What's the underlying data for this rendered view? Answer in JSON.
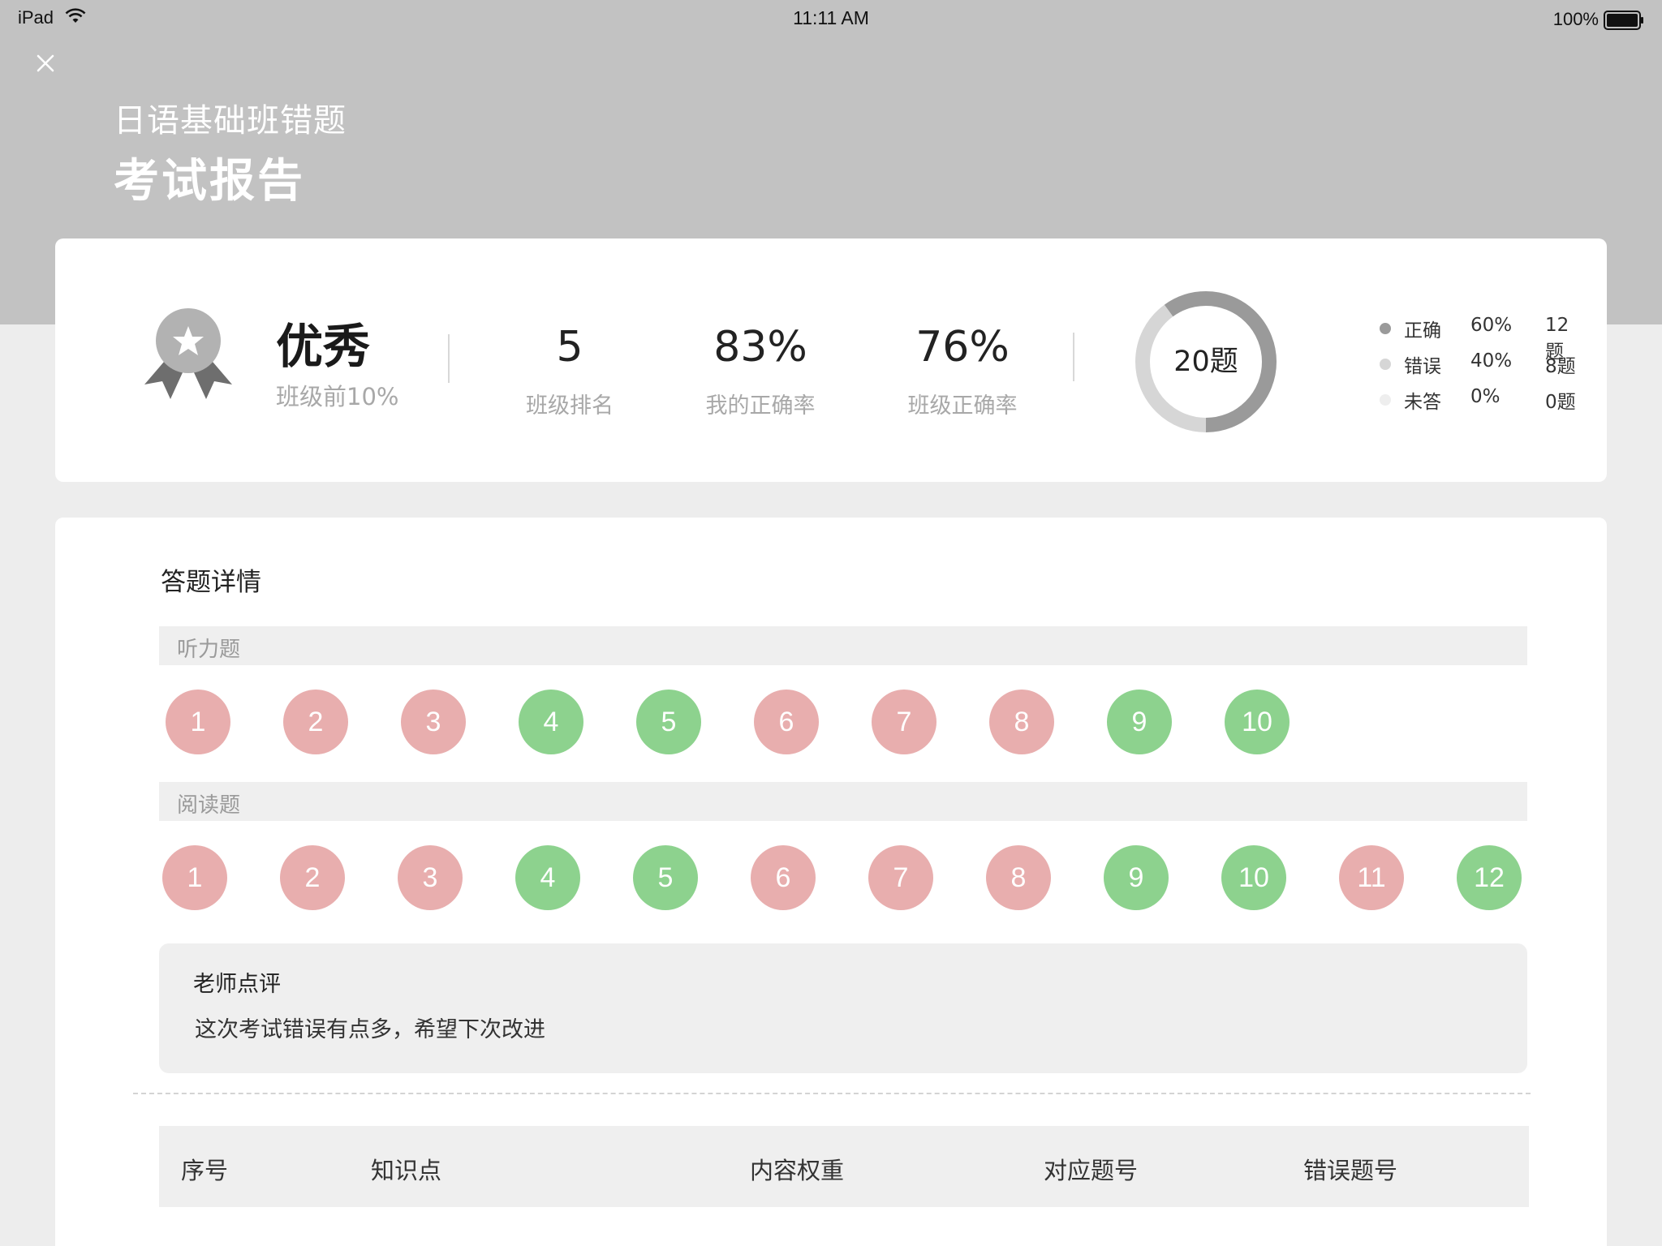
{
  "status_bar": {
    "device": "iPad",
    "time": "11:11 AM",
    "battery": "100%"
  },
  "header": {
    "course_title": "日语基础班错题",
    "report_title": "考试报告"
  },
  "summary": {
    "grade": "优秀",
    "grade_sub": "班级前10%",
    "stats": [
      {
        "value": "5",
        "label": "班级排名"
      },
      {
        "value": "83%",
        "label": "我的正确率"
      },
      {
        "value": "76%",
        "label": "班级正确率"
      }
    ],
    "total": "20题",
    "legend": [
      {
        "name": "正确",
        "pct": "60%",
        "count": "12题",
        "color": "#9a9a9a"
      },
      {
        "name": "错误",
        "pct": "40%",
        "count": "8题",
        "color": "#d6d6d6"
      },
      {
        "name": "未答",
        "pct": "0%",
        "count": "0题",
        "color": "#eeeeee"
      }
    ],
    "donut_fractions": [
      0.6,
      0.4,
      0.0
    ]
  },
  "detail": {
    "section_title": "答题详情",
    "groups": [
      {
        "name": "听力题",
        "questions": [
          {
            "n": "1",
            "status": "wrong"
          },
          {
            "n": "2",
            "status": "wrong"
          },
          {
            "n": "3",
            "status": "wrong"
          },
          {
            "n": "4",
            "status": "correct"
          },
          {
            "n": "5",
            "status": "correct"
          },
          {
            "n": "6",
            "status": "wrong"
          },
          {
            "n": "7",
            "status": "wrong"
          },
          {
            "n": "8",
            "status": "wrong"
          },
          {
            "n": "9",
            "status": "correct"
          },
          {
            "n": "10",
            "status": "correct"
          }
        ]
      },
      {
        "name": "阅读题",
        "questions": [
          {
            "n": "1",
            "status": "wrong"
          },
          {
            "n": "2",
            "status": "wrong"
          },
          {
            "n": "3",
            "status": "wrong"
          },
          {
            "n": "4",
            "status": "correct"
          },
          {
            "n": "5",
            "status": "correct"
          },
          {
            "n": "6",
            "status": "wrong"
          },
          {
            "n": "7",
            "status": "wrong"
          },
          {
            "n": "8",
            "status": "wrong"
          },
          {
            "n": "9",
            "status": "correct"
          },
          {
            "n": "10",
            "status": "correct"
          },
          {
            "n": "11",
            "status": "wrong"
          },
          {
            "n": "12",
            "status": "correct"
          }
        ]
      }
    ],
    "comment": {
      "title": "老师点评",
      "text": "这次考试错误有点多，希望下次改进"
    },
    "table_headers": [
      "序号",
      "知识点",
      "内容权重",
      "对应题号",
      "错误题号"
    ]
  }
}
